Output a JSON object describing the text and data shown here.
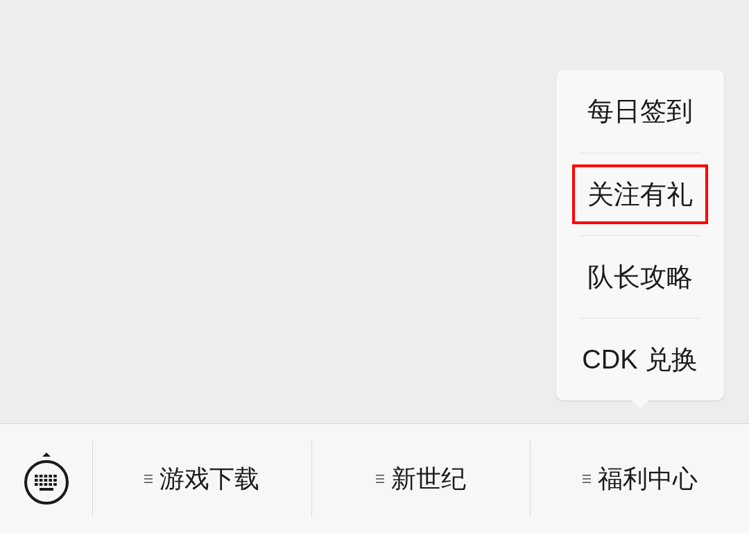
{
  "menu_items": [
    {
      "label": "游戏下载"
    },
    {
      "label": "新世纪"
    },
    {
      "label": "福利中心",
      "submenu": [
        {
          "label": "每日签到",
          "highlighted": false
        },
        {
          "label": "关注有礼",
          "highlighted": true
        },
        {
          "label": "队长攻略",
          "highlighted": false
        },
        {
          "label": "CDK 兑换",
          "highlighted": false
        }
      ]
    }
  ]
}
